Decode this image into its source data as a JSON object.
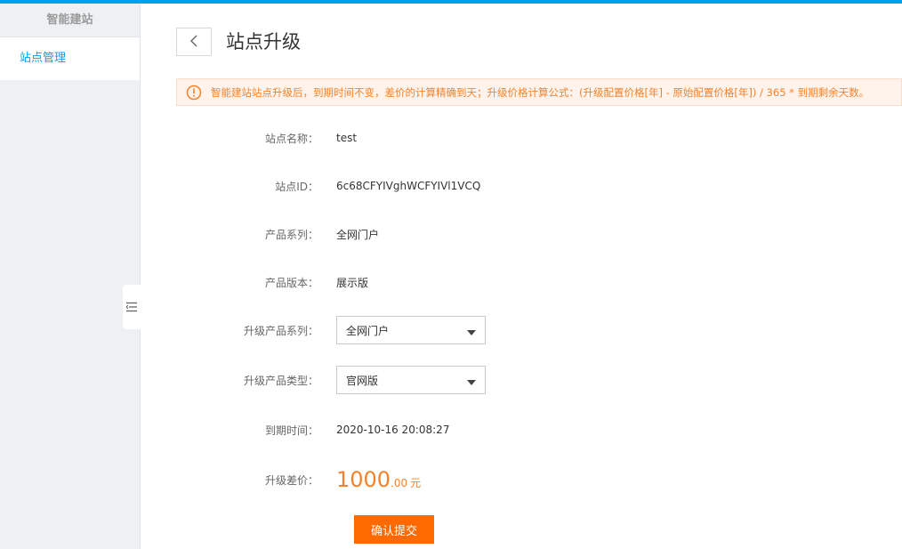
{
  "colors": {
    "accent_blue": "#00a2ef",
    "orange": "#ff6a00",
    "alert_text": "#f5822a"
  },
  "sidebar": {
    "title": "智能建站",
    "items": [
      {
        "label": "站点管理",
        "active": true
      }
    ],
    "collapse_icon": "menu-collapse-icon"
  },
  "header": {
    "back_icon": "chevron-left-icon",
    "title": "站点升级"
  },
  "alert": {
    "icon": "warning-circle-icon",
    "text": "智能建站站点升级后，到期时间不变，差价的计算精确到天；升级价格计算公式：(升级配置价格[年] - 原始配置价格[年]) / 365 * 到期剩余天数。"
  },
  "form": {
    "site_name": {
      "label": "站点名称：",
      "value": "test"
    },
    "site_id": {
      "label": "站点ID：",
      "value": "6c68CFYIVghWCFYIVl1VCQ"
    },
    "product_series": {
      "label": "产品系列：",
      "value": "全网门户"
    },
    "product_version": {
      "label": "产品版本：",
      "value": "展示版"
    },
    "upgrade_series": {
      "label": "升级产品系列：",
      "selected": "全网门户",
      "icon": "caret-down-icon"
    },
    "upgrade_type": {
      "label": "升级产品类型：",
      "selected": "官网版",
      "icon": "caret-down-icon"
    },
    "expire_time": {
      "label": "到期时间：",
      "value": "2020-10-16 20:08:27"
    },
    "price_diff": {
      "label": "升级差价：",
      "integer": "1000",
      "decimal": ".00",
      "unit": "元"
    }
  },
  "submit": {
    "label": "确认提交"
  }
}
